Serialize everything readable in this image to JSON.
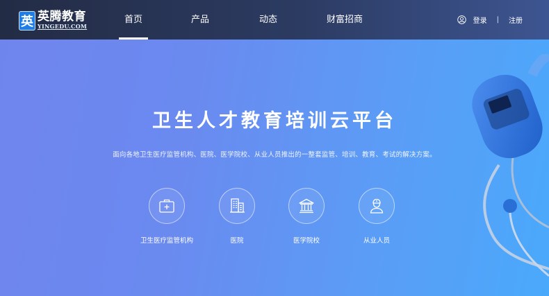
{
  "logo": {
    "name": "英腾教育",
    "mark": "英",
    "domain": "YINGEDU.COM"
  },
  "nav": {
    "items": [
      {
        "label": "首页",
        "active": true
      },
      {
        "label": "产品",
        "active": false
      },
      {
        "label": "动态",
        "active": false
      },
      {
        "label": "财富招商",
        "active": false
      }
    ]
  },
  "user": {
    "login": "登录",
    "separator": "|",
    "register": "注册"
  },
  "hero": {
    "title": "卫生人才教育培训云平台",
    "subtitle": "面向各地卫生医疗监管机构、医院、医学院校、从业人员推出的一整套监管、培训、教育、考试的解决方案。"
  },
  "features": [
    {
      "label": "卫生医疗监管机构",
      "icon": "medical-kit-icon"
    },
    {
      "label": "医院",
      "icon": "hospital-building-icon"
    },
    {
      "label": "医学院校",
      "icon": "school-building-icon"
    },
    {
      "label": "从业人员",
      "icon": "doctor-person-icon"
    }
  ],
  "colors": {
    "nav_bg": "#232c45",
    "accent": "#1f7de8",
    "hero_bg": "#6a8af0"
  }
}
